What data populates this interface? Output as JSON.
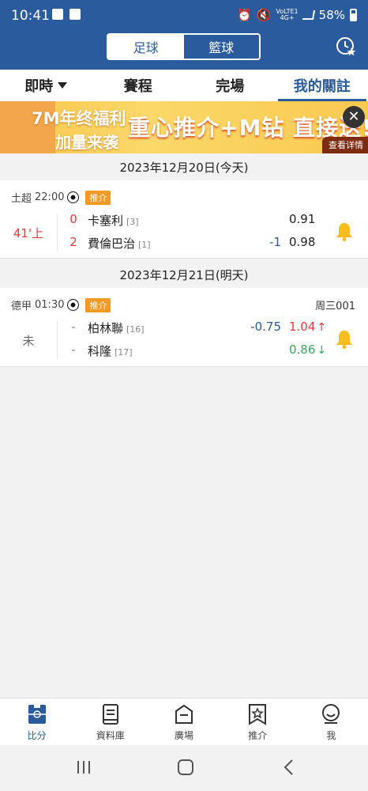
{
  "status_bar": {
    "time": "10:41",
    "network_top": "VoLTE1",
    "network_bottom": "4G+",
    "battery": "58%"
  },
  "sport_toggle": {
    "football": "足球",
    "basketball": "籃球",
    "active": "football"
  },
  "tabs": [
    {
      "label": "即時",
      "has_dropdown": true
    },
    {
      "label": "賽程"
    },
    {
      "label": "完場"
    },
    {
      "label": "我的關註",
      "active": true
    }
  ],
  "banner": {
    "left_line1": "7M年终福利",
    "left_line2": "加量来袭",
    "headline": "重心推介+M钻 直接送!",
    "detail_label": "查看详情",
    "close_glyph": "✕"
  },
  "sections": [
    {
      "date": "2023年12月20日(今天)",
      "match": {
        "league": "土超",
        "time": "22:00",
        "badge": "推介",
        "round_no": "",
        "status": "41'上",
        "home": {
          "score": "0",
          "name": "卡塞利",
          "rank": "[3]"
        },
        "away": {
          "score": "2",
          "name": "費倫巴治",
          "rank": "[1]"
        },
        "handicap": "-1",
        "odds_home": "0.91",
        "odds_away": "0.98"
      }
    },
    {
      "date": "2023年12月21日(明天)",
      "match": {
        "league": "德甲",
        "time": "01:30",
        "badge": "推介",
        "round_no": "周三001",
        "status": "未",
        "home": {
          "score": "-",
          "name": "柏林聯",
          "rank": "[16]"
        },
        "away": {
          "score": "-",
          "name": "科隆",
          "rank": "[17]"
        },
        "handicap": "-0.75",
        "odds_home": "1.04",
        "odds_home_arrow": "↑",
        "odds_away": "0.86",
        "odds_away_arrow": "↓"
      }
    }
  ],
  "bottom_nav": [
    {
      "label": "比分",
      "icon": "scoreboard-icon",
      "active": true
    },
    {
      "label": "資料庫",
      "icon": "book-icon"
    },
    {
      "label": "廣場",
      "icon": "square-icon"
    },
    {
      "label": "推介",
      "icon": "star-tag-icon"
    },
    {
      "label": "我",
      "icon": "user-icon"
    }
  ],
  "colors": {
    "primary": "#2a5b9c",
    "accent": "#f39a23",
    "up": "#e33a3a",
    "down": "#3aa860"
  }
}
